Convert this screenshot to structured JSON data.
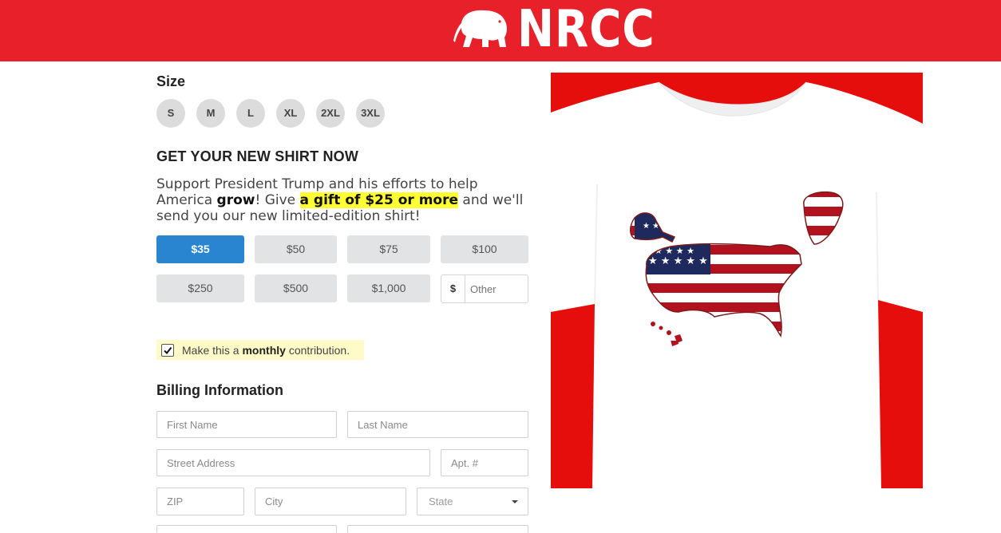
{
  "header": {
    "brand": "NRCC",
    "logo_icon": "elephant-icon",
    "bg_color": "#e8202a"
  },
  "size": {
    "title": "Size",
    "options": [
      "S",
      "M",
      "L",
      "XL",
      "2XL",
      "3XL"
    ]
  },
  "offer": {
    "heading": "GET YOUR NEW SHIRT NOW",
    "pitch_1": "Support President Trump and his efforts to help America ",
    "pitch_bold": "grow",
    "pitch_2": "! Give ",
    "pitch_highlight": "a gift of $25 or more",
    "pitch_3": " and we'll send you our new limited-edition shirt!"
  },
  "amounts": {
    "options": [
      "$35",
      "$50",
      "$75",
      "$100",
      "$250",
      "$500",
      "$1,000"
    ],
    "selected": "$35",
    "other_currency": "$",
    "other_placeholder": "Other",
    "active_color": "#2a85d0"
  },
  "monthly": {
    "checked": true,
    "label_1": "Make this a ",
    "label_bold": "monthly",
    "label_2": " contribution."
  },
  "billing": {
    "title": "Billing Information",
    "first_name_placeholder": "First Name",
    "last_name_placeholder": "Last Name",
    "street_placeholder": "Street Address",
    "apt_placeholder": "Apt. #",
    "zip_placeholder": "ZIP",
    "city_placeholder": "City",
    "state_placeholder": "State"
  },
  "product": {
    "image": "american-flag-map-tshirt",
    "bg_color": "#e60d0d"
  }
}
